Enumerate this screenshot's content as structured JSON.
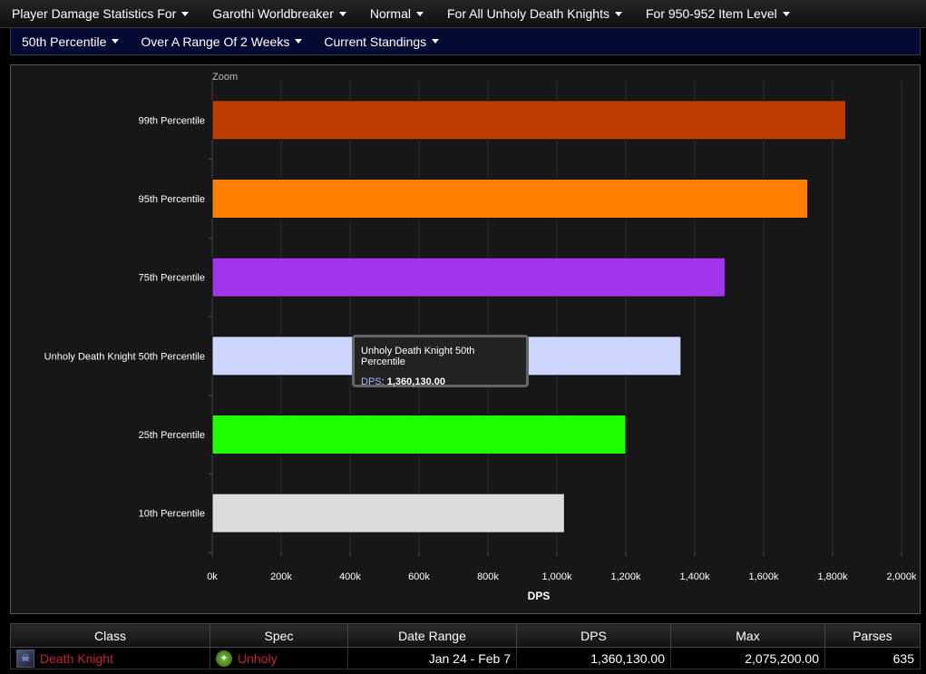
{
  "menu_row1": [
    "Player Damage Statistics For",
    "Garothi Worldbreaker",
    "Normal",
    "For All Unholy Death Knights",
    "For 950-952 Item Level"
  ],
  "menu_row2": [
    "50th Percentile",
    "Over A Range Of 2 Weeks",
    "Current Standings"
  ],
  "colors": {
    "panel_bg": "#171717",
    "grid": "#2c2c2c",
    "highlight_class": "#c41f3b"
  },
  "chart_data": {
    "type": "bar",
    "orientation": "horizontal",
    "zoom_label": "Zoom",
    "categories": [
      "99th Percentile",
      "95th Percentile",
      "75th Percentile",
      "Unholy Death Knight 50th Percentile",
      "25th Percentile",
      "10th Percentile"
    ],
    "values": [
      1838000,
      1728000,
      1488000,
      1360130,
      1200000,
      1022000
    ],
    "bar_colors": [
      "#be3c00",
      "#ff8000",
      "#a335ee",
      "#cdd6ff",
      "#1eff00",
      "#dcdcdc"
    ],
    "xlabel": "DPS",
    "xlim": [
      0,
      2000000
    ],
    "xticks": [
      "0k",
      "200k",
      "400k",
      "600k",
      "800k",
      "1,000k",
      "1,200k",
      "1,400k",
      "1,600k",
      "1,800k",
      "2,000k"
    ],
    "grid": true,
    "tooltip": {
      "title": "Unholy Death Knight 50th Percentile",
      "key": "DPS",
      "value": "1,360,130.00"
    }
  },
  "table": {
    "headers": [
      "Class",
      "Spec",
      "Date Range",
      "DPS",
      "Max",
      "Parses"
    ],
    "row": {
      "class": "Death Knight",
      "spec": "Unholy",
      "date_range": "Jan 24 - Feb 7",
      "dps": "1,360,130.00",
      "max": "2,075,200.00",
      "parses": "635"
    }
  }
}
